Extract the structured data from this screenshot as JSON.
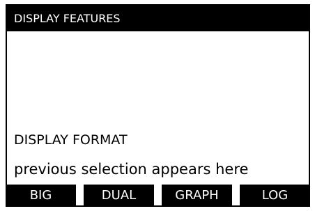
{
  "header": {
    "title": "DISPLAY FEATURES"
  },
  "main": {
    "prompt": "DISPLAY FORMAT",
    "selection_text": "previous selection appears here"
  },
  "softkeys": [
    {
      "label": "BIG"
    },
    {
      "label": "DUAL"
    },
    {
      "label": "GRAPH"
    },
    {
      "label": "LOG"
    }
  ],
  "colors": {
    "background": "#ffffff",
    "foreground": "#000000",
    "inverse_text": "#ffffff"
  }
}
